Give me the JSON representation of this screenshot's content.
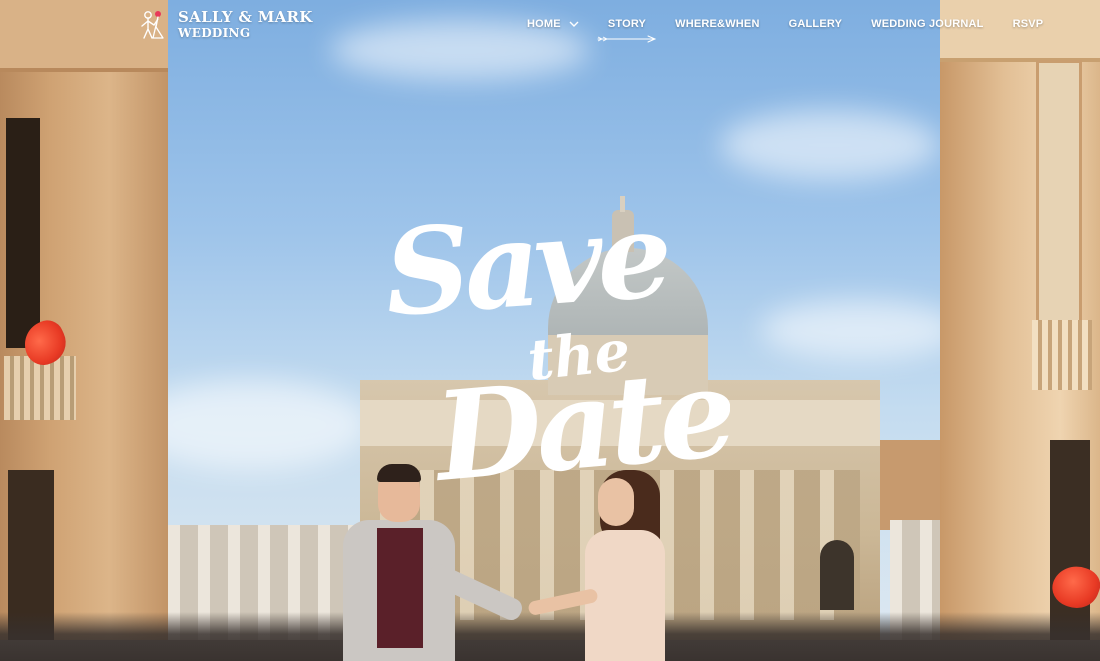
{
  "brand": {
    "title": "SALLY & MARK",
    "subtitle": "WEDDING",
    "logo_icon": "couple-logo-icon"
  },
  "nav": {
    "items": [
      {
        "label": "HOME",
        "has_dropdown": true
      },
      {
        "label": "STORY",
        "active": true
      },
      {
        "label": "WHERE&WHEN"
      },
      {
        "label": "GALLERY"
      },
      {
        "label": "WEDDING JOURNAL"
      },
      {
        "label": "RSVP"
      }
    ]
  },
  "hero": {
    "line1": "Save",
    "line2": "the",
    "line3": "Date"
  },
  "colors": {
    "nav_text": "#ffffff",
    "hero_text": "#ffffff",
    "petal": "#e83a24",
    "sky": "#9ec4ea"
  }
}
